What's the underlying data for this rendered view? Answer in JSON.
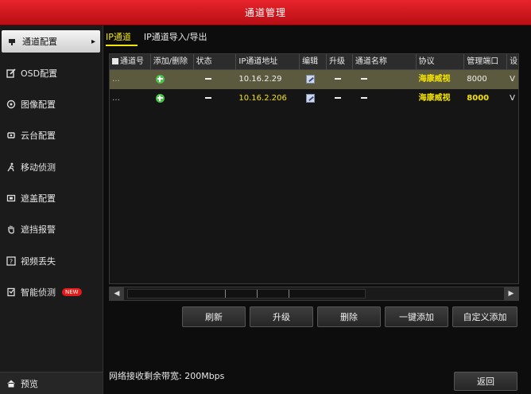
{
  "window": {
    "title": "通道管理"
  },
  "sidebar": {
    "items": [
      {
        "label": "通道配置",
        "icon": "camera-icon",
        "active": true
      },
      {
        "label": "OSD配置",
        "icon": "edit-icon",
        "active": false
      },
      {
        "label": "图像配置",
        "icon": "image-icon",
        "active": false
      },
      {
        "label": "云台配置",
        "icon": "ptz-icon",
        "active": false
      },
      {
        "label": "移动侦测",
        "icon": "running-person-icon",
        "active": false
      },
      {
        "label": "遮盖配置",
        "icon": "mask-icon",
        "active": false
      },
      {
        "label": "遮挡报警",
        "icon": "hand-icon",
        "active": false
      },
      {
        "label": "视频丢失",
        "icon": "question-icon",
        "active": false
      },
      {
        "label": "智能侦测",
        "icon": "smart-detect-icon",
        "active": false,
        "badge": "NEW"
      }
    ],
    "bottom": {
      "label": "预览",
      "icon": "home-icon"
    }
  },
  "tabs": [
    {
      "label": "IP通道",
      "active": true
    },
    {
      "label": "IP通道导入/导出",
      "active": false
    }
  ],
  "table": {
    "columns": [
      "通道号",
      "添加/删除",
      "状态",
      "IP通道地址",
      "编辑",
      "升级",
      "通道名称",
      "协议",
      "管理端口",
      "设"
    ],
    "rows": [
      {
        "channel": "…",
        "ip": "10.16.2.29",
        "protocol": "海康威视",
        "port": "8000",
        "extra": "V",
        "selected": true
      },
      {
        "channel": "…",
        "ip": "10.16.2.206",
        "protocol": "海康威视",
        "port": "8000",
        "extra": "V",
        "selected": false
      }
    ]
  },
  "buttons": {
    "refresh": "刷新",
    "upgrade": "升级",
    "delete": "删除",
    "one_click_add": "一键添加",
    "custom_add": "自定义添加",
    "back": "返回"
  },
  "status": {
    "bandwidth": "网络接收剩余带宽: 200Mbps"
  },
  "colors": {
    "title_bar": "#d41a20",
    "highlight": "#f4e400",
    "selected_row": "#5c5a3e"
  }
}
